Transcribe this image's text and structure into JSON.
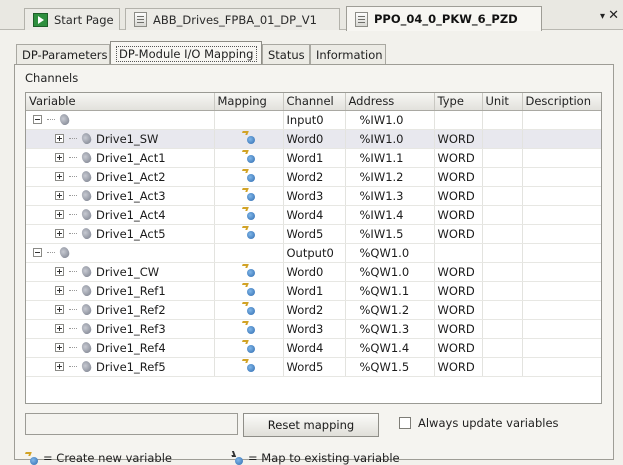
{
  "doc_tabs": [
    {
      "label": "Start Page",
      "icon": "start-page-icon"
    },
    {
      "label": "ABB_Drives_FPBA_01_DP_V1",
      "icon": "document-icon"
    },
    {
      "label": "PPO_04_0_PKW_6_PZD",
      "icon": "document-icon",
      "active": true
    }
  ],
  "doc_tab_controls": {
    "scroll_glyph": "▾",
    "close_glyph": "✕"
  },
  "prop_tabs": [
    {
      "label": "DP-Parameters"
    },
    {
      "label": "DP-Module I/O Mapping",
      "active": true
    },
    {
      "label": "Status"
    },
    {
      "label": "Information"
    }
  ],
  "channels_label": "Channels",
  "grid": {
    "columns": [
      "Variable",
      "Mapping",
      "Channel",
      "Address",
      "Type",
      "Unit",
      "Description"
    ],
    "rows": [
      {
        "kind": "group",
        "variable": "",
        "channel": "Input0",
        "address": "%IW1.0",
        "type": ""
      },
      {
        "kind": "item",
        "variable": "Drive1_SW",
        "channel": "Word0",
        "address": "%IW1.0",
        "type": "WORD",
        "selected": true
      },
      {
        "kind": "item",
        "variable": "Drive1_Act1",
        "channel": "Word1",
        "address": "%IW1.1",
        "type": "WORD"
      },
      {
        "kind": "item",
        "variable": "Drive1_Act2",
        "channel": "Word2",
        "address": "%IW1.2",
        "type": "WORD"
      },
      {
        "kind": "item",
        "variable": "Drive1_Act3",
        "channel": "Word3",
        "address": "%IW1.3",
        "type": "WORD"
      },
      {
        "kind": "item",
        "variable": "Drive1_Act4",
        "channel": "Word4",
        "address": "%IW1.4",
        "type": "WORD"
      },
      {
        "kind": "item",
        "variable": "Drive1_Act5",
        "channel": "Word5",
        "address": "%IW1.5",
        "type": "WORD"
      },
      {
        "kind": "group",
        "variable": "",
        "channel": "Output0",
        "address": "%QW1.0",
        "type": ""
      },
      {
        "kind": "item",
        "variable": "Drive1_CW",
        "channel": "Word0",
        "address": "%QW1.0",
        "type": "WORD"
      },
      {
        "kind": "item",
        "variable": "Drive1_Ref1",
        "channel": "Word1",
        "address": "%QW1.1",
        "type": "WORD"
      },
      {
        "kind": "item",
        "variable": "Drive1_Ref2",
        "channel": "Word2",
        "address": "%QW1.2",
        "type": "WORD"
      },
      {
        "kind": "item",
        "variable": "Drive1_Ref3",
        "channel": "Word3",
        "address": "%QW1.3",
        "type": "WORD"
      },
      {
        "kind": "item",
        "variable": "Drive1_Ref4",
        "channel": "Word4",
        "address": "%QW1.4",
        "type": "WORD"
      },
      {
        "kind": "item",
        "variable": "Drive1_Ref5",
        "channel": "Word5",
        "address": "%QW1.5",
        "type": "WORD"
      }
    ]
  },
  "controls": {
    "reset_label": "Reset mapping",
    "always_update_label": "Always update variables",
    "always_update_checked": false
  },
  "legend": {
    "create_label": "= Create new variable",
    "create_icon": "create-variable-icon",
    "map_label": "= Map to existing variable",
    "map_icon": "map-existing-icon"
  }
}
